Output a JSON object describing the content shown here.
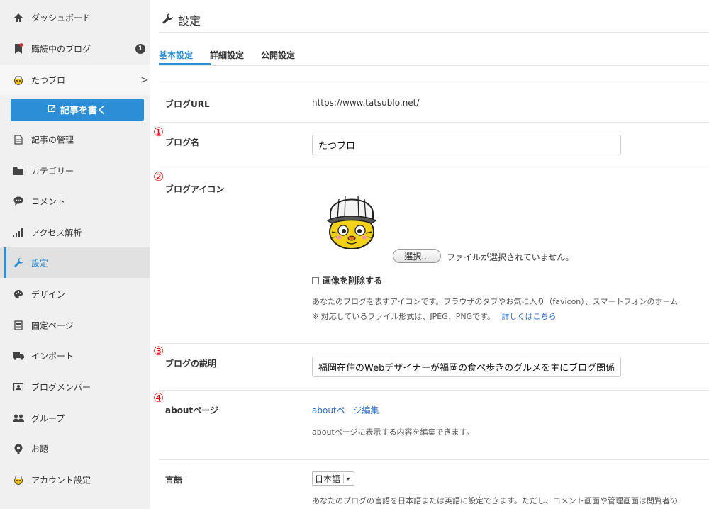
{
  "sidebar": {
    "items": [
      {
        "label": "ダッシュボード",
        "icon": "home-icon"
      },
      {
        "label": "購読中のブログ",
        "icon": "bookmark-icon",
        "badge": "1"
      },
      {
        "label": "たつブロ",
        "icon": "blog-avatar-icon",
        "chevron": ">"
      },
      {
        "label": "記事の管理",
        "icon": "document-icon"
      },
      {
        "label": "カテゴリー",
        "icon": "folder-icon"
      },
      {
        "label": "コメント",
        "icon": "comment-icon"
      },
      {
        "label": "アクセス解析",
        "icon": "bar-chart-icon"
      },
      {
        "label": "設定",
        "icon": "wrench-icon"
      },
      {
        "label": "デザイン",
        "icon": "palette-icon"
      },
      {
        "label": "固定ページ",
        "icon": "page-icon"
      },
      {
        "label": "インポート",
        "icon": "truck-icon"
      },
      {
        "label": "ブログメンバー",
        "icon": "member-card-icon"
      },
      {
        "label": "グループ",
        "icon": "group-icon"
      },
      {
        "label": "お題",
        "icon": "topic-icon"
      },
      {
        "label": "アカウント設定",
        "icon": "account-avatar-icon"
      }
    ],
    "write_button": "記事を書く"
  },
  "header": {
    "title": "設定"
  },
  "tabs": [
    {
      "label": "基本設定",
      "active": true
    },
    {
      "label": "詳細設定"
    },
    {
      "label": "公開設定"
    }
  ],
  "form": {
    "blog_url": {
      "label": "ブログURL",
      "value": "https://www.tatsublo.net/"
    },
    "blog_name": {
      "number": "①",
      "label": "ブログ名",
      "value": "たつブロ"
    },
    "blog_icon": {
      "number": "②",
      "label": "ブログアイコン",
      "file_button": "選択...",
      "file_status": "ファイルが選択されていません。",
      "delete_checkbox": "画像を削除する",
      "desc1": "あなたのブログを表すアイコンです。ブラウザのタブやお気に入り（favicon）、スマートフォンのホーム",
      "desc2": "※ 対応しているファイル形式は、JPEG、PNGです。",
      "more_link": "詳しくはこちら"
    },
    "blog_description": {
      "number": "③",
      "label": "ブログの説明",
      "value": "福岡在住のWebデザイナーが福岡の食べ歩きのグルメを主にブログ関係"
    },
    "about_page": {
      "number": "④",
      "label": "aboutページ",
      "link": "aboutページ編集",
      "desc": "aboutページに表示する内容を編集できます。"
    },
    "language": {
      "label": "言語",
      "selected": "日本語",
      "desc": "あなたのブログの言語を日本語または英語に設定できます。ただし、コメント画面や管理画面は閲覧者の"
    }
  },
  "colors": {
    "accent": "#2b8ed6",
    "annotation": "#e40000"
  }
}
